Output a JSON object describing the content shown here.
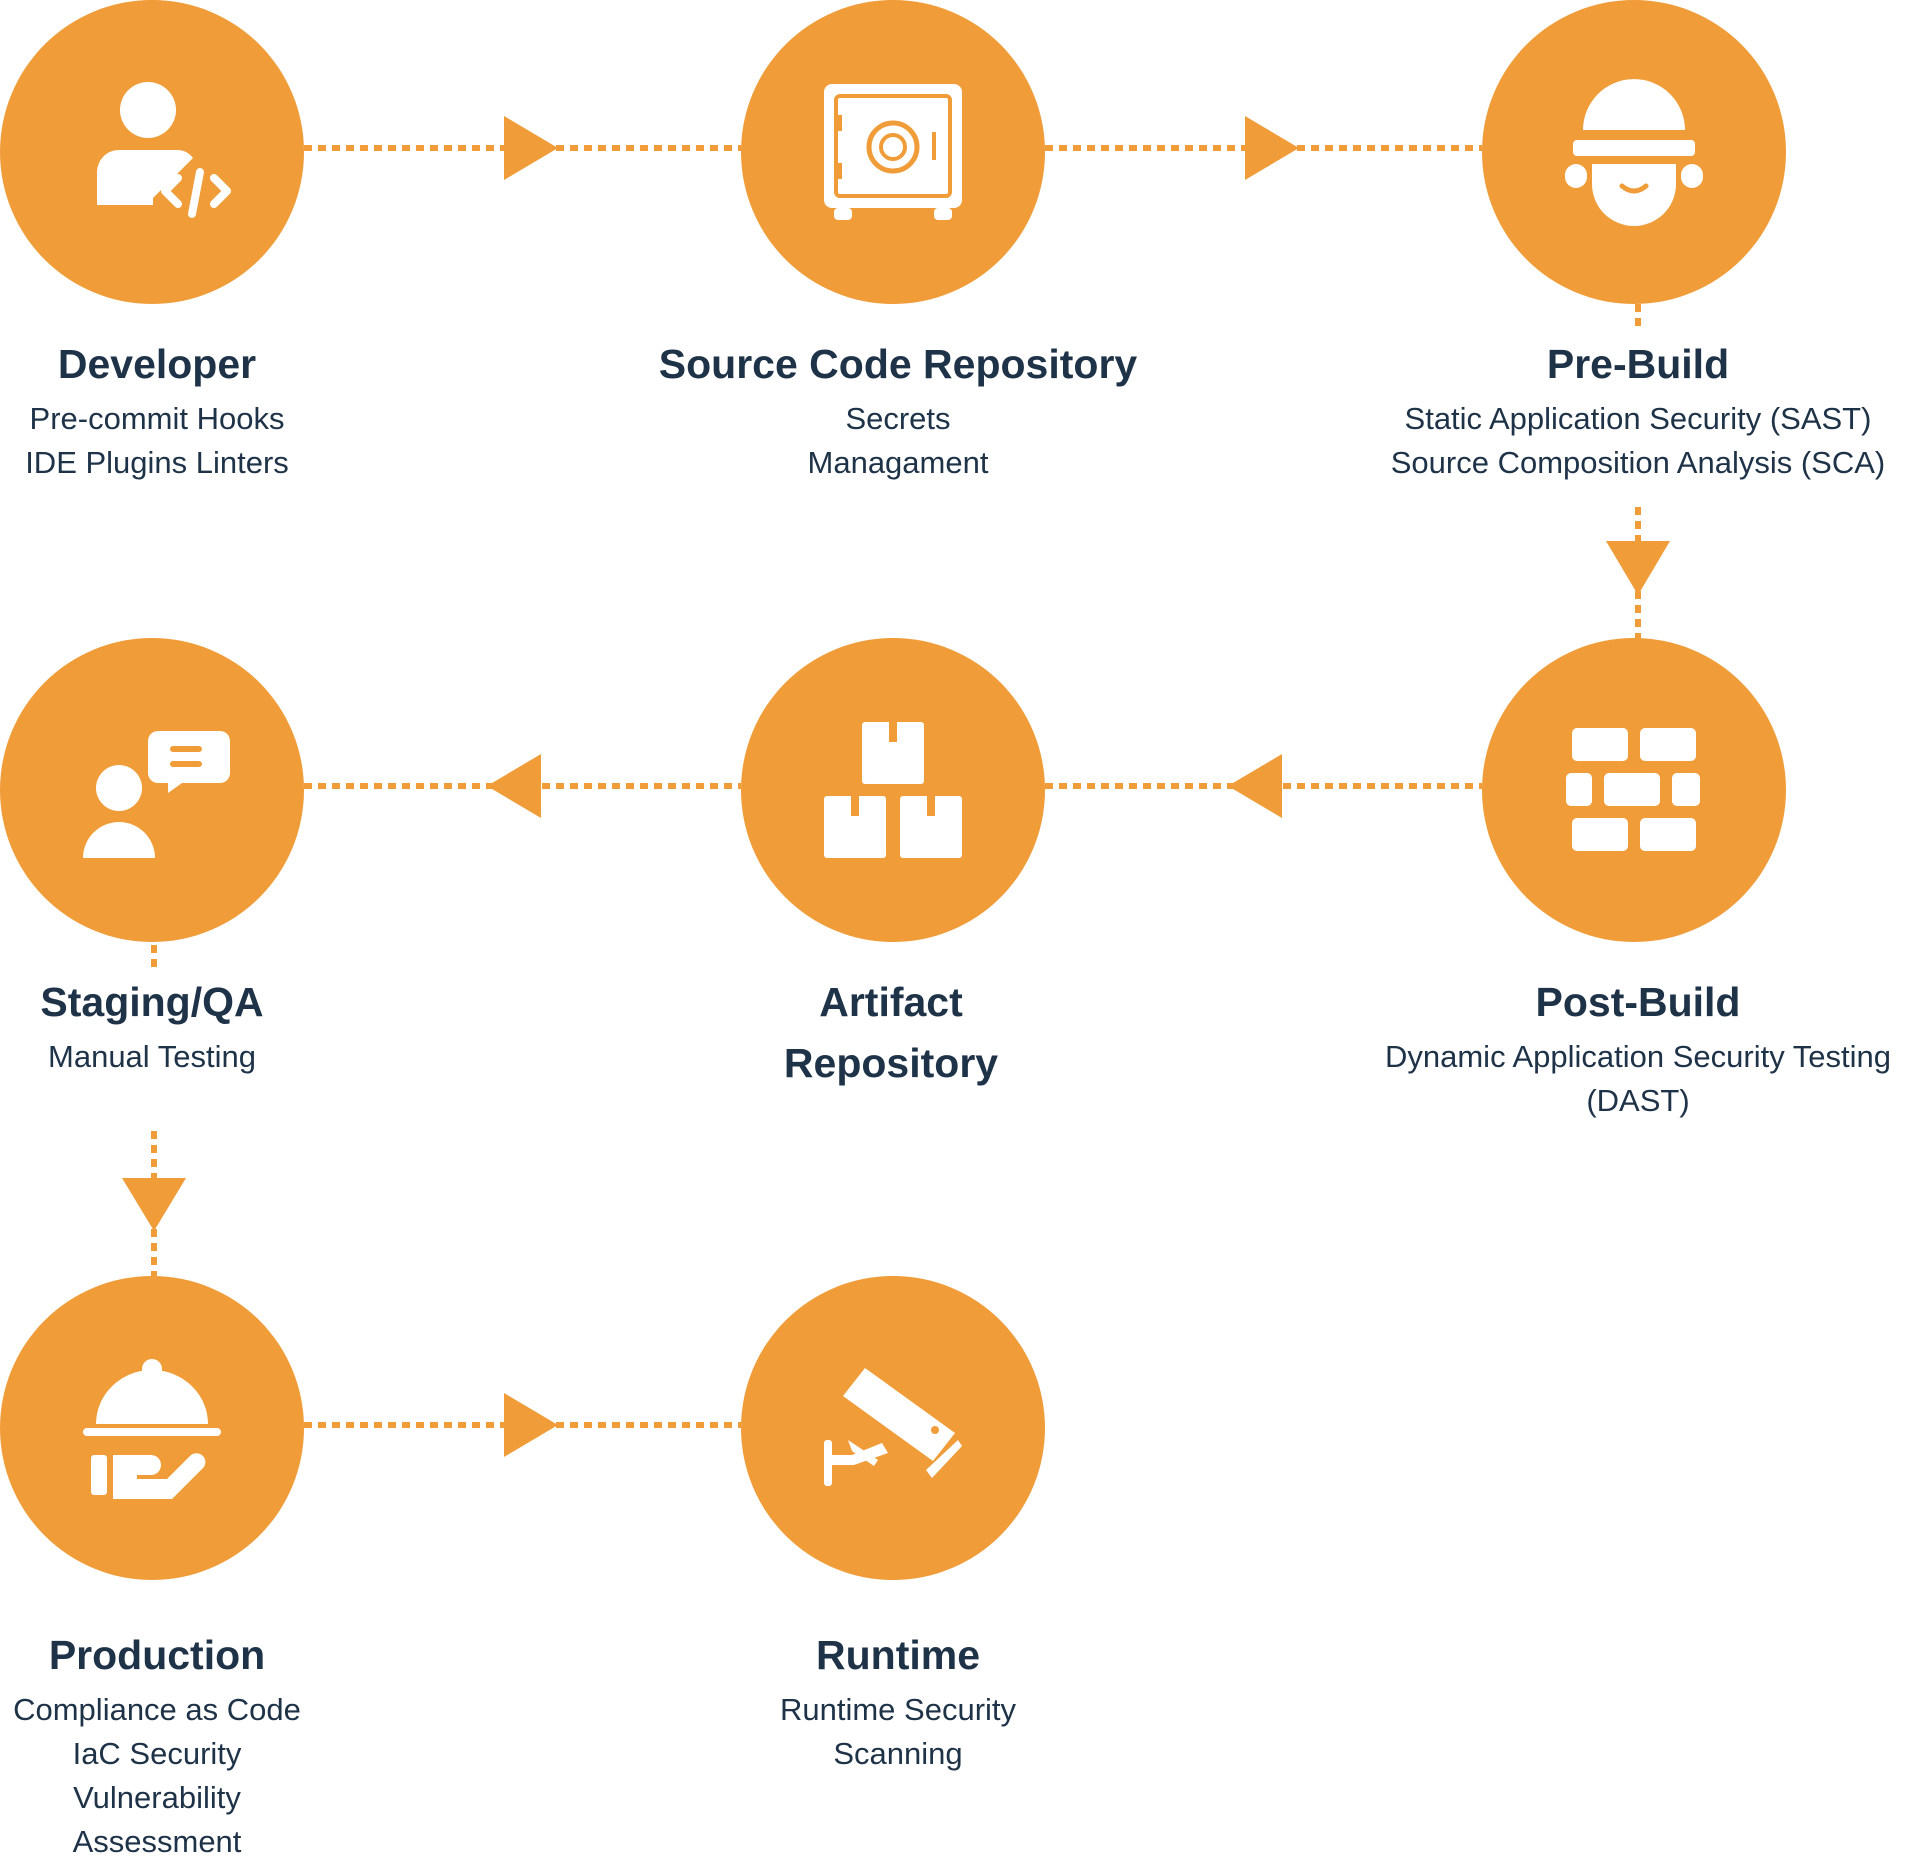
{
  "colors": {
    "accent": "#F09C38",
    "text": "#1E3248",
    "icon": "#FFFFFF"
  },
  "stages": [
    {
      "id": "developer",
      "title": "Developer",
      "icon": "developer-code-icon",
      "lines": [
        "Pre-commit Hooks",
        "IDE Plugins Linters"
      ]
    },
    {
      "id": "source-code-repository",
      "title": "Source Code Repository",
      "icon": "safe-vault-icon",
      "lines": [
        "Secrets",
        "Managament"
      ]
    },
    {
      "id": "pre-build",
      "title": "Pre-Build",
      "icon": "hard-hat-worker-icon",
      "lines": [
        "Static Application Security (SAST)",
        "Source Composition Analysis (SCA)"
      ]
    },
    {
      "id": "post-build",
      "title": "Post-Build",
      "icon": "brick-wall-icon",
      "lines": [
        "Dynamic Application Security Testing",
        "(DAST)"
      ]
    },
    {
      "id": "artifact-repository",
      "title": "Artifact\nRepository",
      "title_lines": [
        "Artifact",
        "Repository"
      ],
      "icon": "stacked-boxes-icon",
      "lines": []
    },
    {
      "id": "staging-qa",
      "title": "Staging/QA",
      "icon": "person-chat-icon",
      "lines": [
        "Manual Testing"
      ]
    },
    {
      "id": "production",
      "title": "Production",
      "icon": "serving-cloche-icon",
      "lines": [
        "Compliance as Code",
        "IaC Security",
        "Vulnerability",
        "Assessment"
      ]
    },
    {
      "id": "runtime",
      "title": "Runtime",
      "icon": "security-camera-icon",
      "lines": [
        "Runtime Security",
        "Scanning"
      ]
    }
  ],
  "flow": [
    "developer",
    "source-code-repository",
    "pre-build",
    "post-build",
    "artifact-repository",
    "staging-qa",
    "production",
    "runtime"
  ]
}
